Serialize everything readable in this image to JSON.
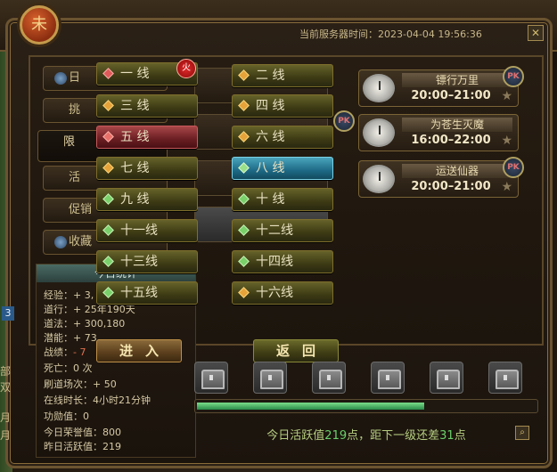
{
  "header": {
    "emblem_char": "未",
    "server_time_label": "当前服务器时间：",
    "server_time": "2023-04-04 19:56:36",
    "close_symbol": "✕"
  },
  "sidebar": {
    "items": [
      {
        "label": "日"
      },
      {
        "label": "挑"
      },
      {
        "label": "限"
      },
      {
        "label": "活"
      },
      {
        "label": "促销"
      },
      {
        "label": "收藏"
      }
    ]
  },
  "stats": {
    "title": "今日统计",
    "rows": [
      {
        "label": "经验：",
        "value": "+ 3,"
      },
      {
        "label": "道行：",
        "value": "+ 25年190天"
      },
      {
        "label": "道法：",
        "value": "+ 300,180"
      },
      {
        "label": "潜能：",
        "value": "+ 73,"
      },
      {
        "label": "战绩：",
        "value": "- 7"
      },
      {
        "label": "死亡：",
        "value": "0 次"
      },
      {
        "label": "刷道场次：",
        "value": "+ 50"
      },
      {
        "label": "在线时长：",
        "value": "4小时21分钟"
      },
      {
        "label": "功勋值：",
        "value": "0"
      },
      {
        "label": "今日荣誉值：",
        "value": "800"
      },
      {
        "label": "昨日活跃值：",
        "value": "219"
      }
    ]
  },
  "events": [
    {
      "name": "镖行万里",
      "time": "20:00–21:00",
      "badge": "PK",
      "icon": "clock-icon"
    },
    {
      "name": "为苍生灭魔",
      "time": "16:00–22:00",
      "badge": "PK",
      "icon": "clock-icon"
    },
    {
      "name": "运送仙器",
      "time": "20:00–21:00",
      "badge": "PK",
      "icon": "clock-icon"
    }
  ],
  "line_selector": {
    "hot_badge": "火",
    "lines": [
      {
        "label": "一 线",
        "status": "red"
      },
      {
        "label": "二 线",
        "status": "normal"
      },
      {
        "label": "三 线",
        "status": "normal"
      },
      {
        "label": "四 线",
        "status": "normal"
      },
      {
        "label": "五 线",
        "status": "full"
      },
      {
        "label": "六 线",
        "status": "normal"
      },
      {
        "label": "七 线",
        "status": "normal"
      },
      {
        "label": "八 线",
        "status": "selected"
      },
      {
        "label": "九 线",
        "status": "green"
      },
      {
        "label": "十 线",
        "status": "green"
      },
      {
        "label": "十一线",
        "status": "green"
      },
      {
        "label": "十二线",
        "status": "green"
      },
      {
        "label": "十三线",
        "status": "green"
      },
      {
        "label": "十四线",
        "status": "green"
      },
      {
        "label": "十五线",
        "status": "green"
      },
      {
        "label": "十六线",
        "status": "normal"
      }
    ],
    "enter_label": "进入",
    "back_label": "返回"
  },
  "activity": {
    "prefix": "今日活跃值",
    "value": "219",
    "middle": "点，距下一级还差",
    "remaining": "31",
    "suffix": "点",
    "progress": 0.67
  },
  "left_edge": {
    "level": "3",
    "text1": "部",
    "text2": "双",
    "text3": "月",
    "text4": "月"
  },
  "colors": {
    "selected": "#1e6a86",
    "full": "#6a1e22",
    "normal": "#3c3a14"
  }
}
